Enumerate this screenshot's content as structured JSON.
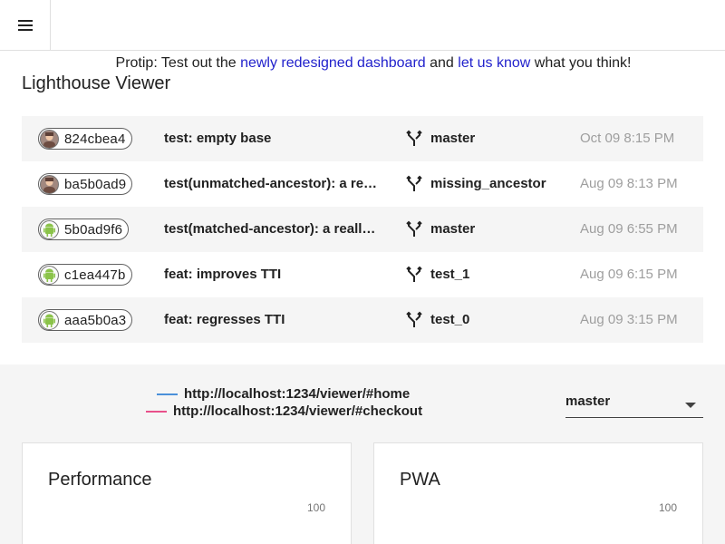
{
  "protip": {
    "prefix": "Protip: Test out the ",
    "link1": "newly redesigned dashboard",
    "middle": " and ",
    "link2": "let us know",
    "suffix": " what you think!"
  },
  "title": "Lighthouse Viewer",
  "builds": [
    {
      "hash": "824cbea4",
      "avatar": "person-avatar",
      "message": "test: empty base",
      "branch": "master",
      "date": "Oct 09 8:15 PM"
    },
    {
      "hash": "ba5b0ad9",
      "avatar": "person-avatar",
      "message": "test(unmatched-ancestor): a re…",
      "branch": "missing_ancestor",
      "date": "Aug 09 8:13 PM"
    },
    {
      "hash": "5b0ad9f6",
      "avatar": "android-avatar",
      "message": "test(matched-ancestor): a reall…",
      "branch": "master",
      "date": "Aug 09 6:55 PM"
    },
    {
      "hash": "c1ea447b",
      "avatar": "android-avatar",
      "message": "feat: improves TTI",
      "branch": "test_1",
      "date": "Aug 09 6:15 PM"
    },
    {
      "hash": "aaa5b0a3",
      "avatar": "android-avatar",
      "message": "feat: regresses TTI",
      "branch": "test_0",
      "date": "Aug 09 3:15 PM"
    }
  ],
  "legend": [
    {
      "url": "http://localhost:1234/viewer/#home",
      "color": "#4a90d9"
    },
    {
      "url": "http://localhost:1234/viewer/#checkout",
      "color": "#e8508a"
    }
  ],
  "branch_select": {
    "value": "master"
  },
  "cards": [
    {
      "title": "Performance",
      "tick": "100"
    },
    {
      "title": "PWA",
      "tick": "100"
    }
  ],
  "icons": {
    "menu": "menu-icon",
    "branch": "git-branch-icon",
    "dropdown": "caret-down-icon"
  }
}
